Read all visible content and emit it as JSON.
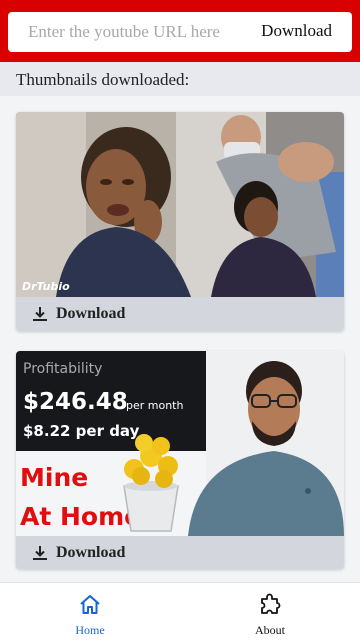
{
  "header": {
    "url_placeholder": "Enter the youtube URL here",
    "url_value": "",
    "download_label": "Download",
    "bar_color": "#d90000"
  },
  "section": {
    "title": "Thumbnails downloaded:"
  },
  "thumbnails": [
    {
      "watermark": "DrTubio",
      "download_label": "Download"
    },
    {
      "caption_label": "Profitability",
      "amount": "$246.48",
      "amount_unit": "per month",
      "daily": "$8.22 per day",
      "headline_line1": "Mine",
      "headline_line2": "At Home!",
      "download_label": "Download"
    }
  ],
  "nav": {
    "items": [
      {
        "label": "Home",
        "icon": "home-icon",
        "active": true
      },
      {
        "label": "About",
        "icon": "puzzle-icon",
        "active": false
      }
    ],
    "active_color": "#1565d8"
  }
}
